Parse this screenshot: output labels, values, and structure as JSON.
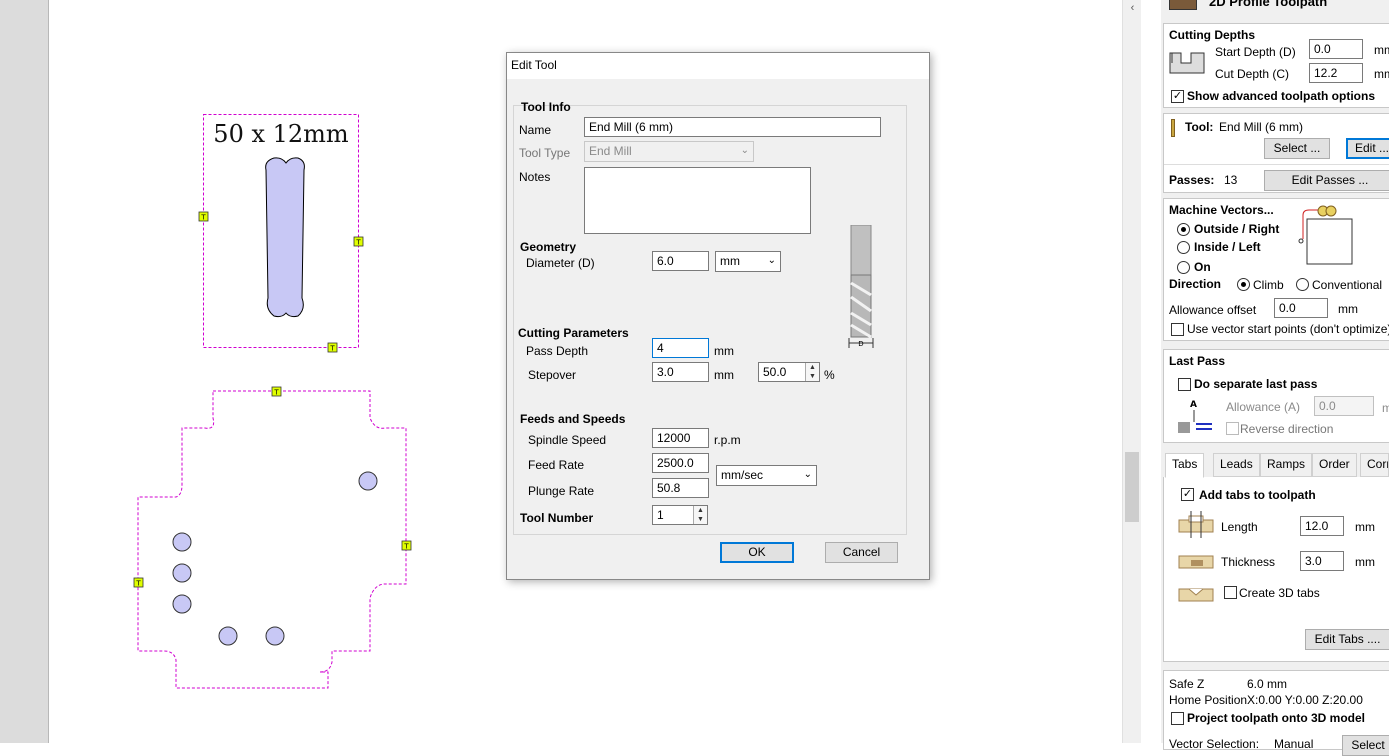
{
  "scrollbar": {
    "up_arrow": "‹"
  },
  "canvas": {
    "label_text": "50 x 12mm",
    "tab_marker": "T"
  },
  "dialog": {
    "title": "Edit Tool",
    "tool_info": {
      "heading": "Tool Info",
      "name_label": "Name",
      "name_value": "End Mill (6 mm)",
      "tool_type_label": "Tool Type",
      "tool_type_value": "End Mill",
      "notes_label": "Notes",
      "notes_value": ""
    },
    "geometry": {
      "heading": "Geometry",
      "diameter_label": "Diameter (D)",
      "diameter_value": "6.0",
      "unit_value": "mm",
      "diagram_label": "D"
    },
    "cutting": {
      "heading": "Cutting Parameters",
      "pass_depth_label": "Pass Depth",
      "pass_depth_value": "4",
      "pass_depth_unit": "mm",
      "stepover_label": "Stepover",
      "stepover_value": "3.0",
      "stepover_unit": "mm",
      "stepover_pct_value": "50.0",
      "pct_symbol": "%"
    },
    "feeds": {
      "heading": "Feeds and Speeds",
      "spindle_label": "Spindle Speed",
      "spindle_value": "12000",
      "spindle_unit": "r.p.m",
      "feed_label": "Feed Rate",
      "feed_value": "2500.0",
      "rate_unit": "mm/sec",
      "plunge_label": "Plunge Rate",
      "plunge_value": "50.8"
    },
    "tool_number": {
      "label": "Tool Number",
      "value": "1"
    },
    "ok_label": "OK",
    "cancel_label": "Cancel"
  },
  "panel": {
    "header_title": "2D Profile Toolpath",
    "cutting_depths": {
      "heading": "Cutting Depths",
      "start_label": "Start Depth (D)",
      "start_value": "0.0",
      "cut_label": "Cut Depth (C)",
      "cut_value": "12.2",
      "unit": "mm",
      "advanced_label": "Show advanced toolpath options",
      "advanced_checked": "✓"
    },
    "tool": {
      "label": "Tool:",
      "value": "End Mill (6 mm)",
      "select_label": "Select ...",
      "edit_label": "Edit ...",
      "passes_label": "Passes:",
      "passes_value": "13",
      "edit_passes_label": "Edit Passes ..."
    },
    "machine_vectors": {
      "heading": "Machine Vectors...",
      "outside_label": "Outside / Right",
      "inside_label": "Inside / Left",
      "on_label": "On",
      "direction_label": "Direction",
      "climb_label": "Climb",
      "conventional_label": "Conventional",
      "allowance_label": "Allowance offset",
      "allowance_value": "0.0",
      "allowance_unit": "mm",
      "start_points_label": "Use vector start points (don't optimize)"
    },
    "last_pass": {
      "heading": "Last Pass",
      "separate_label": "Do separate last pass",
      "allowance_label": "Allowance (A)",
      "allowance_value": "0.0",
      "allowance_unit": "mm",
      "reverse_label": "Reverse direction",
      "diagram_label": "A"
    },
    "tabs": {
      "items": [
        "Tabs",
        "Leads",
        "Ramps",
        "Order",
        "Corners"
      ],
      "add_tabs_label": "Add tabs to toolpath",
      "add_tabs_checked": "✓",
      "length_label": "Length",
      "length_value": "12.0",
      "thickness_label": "Thickness",
      "thickness_value": "3.0",
      "unit": "mm",
      "create_3d_label": "Create 3D tabs",
      "edit_tabs_label": "Edit Tabs ...."
    },
    "footer": {
      "safe_z_label": "Safe Z",
      "safe_z_value": "6.0 mm",
      "home_label": "Home Position",
      "home_value": "X:0.00 Y:0.00 Z:20.00",
      "project_label": "Project toolpath onto 3D model",
      "vector_selection_label": "Vector Selection:",
      "vector_selection_value": "Manual",
      "select_label": "Select"
    }
  }
}
